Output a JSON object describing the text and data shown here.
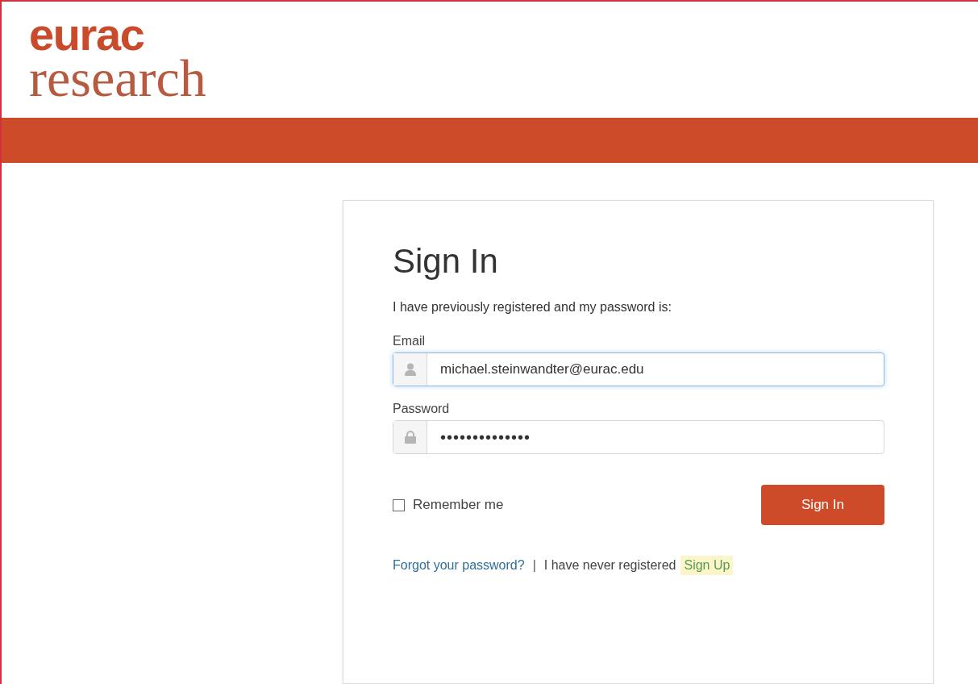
{
  "logo": {
    "top": "eurac",
    "bottom": "research"
  },
  "card": {
    "title": "Sign In",
    "intro": "I have previously registered and my password is:",
    "fields": [
      {
        "kind": "email",
        "label": "Email",
        "value": "michael.steinwandter@eurac.edu",
        "focused": true
      },
      {
        "kind": "password",
        "label": "Password",
        "value": "••••••••••••••",
        "focused": false
      }
    ],
    "remember": {
      "label": "Remember me",
      "checked": false
    },
    "submit": "Sign In",
    "footer": {
      "forgot": "Forgot your password?",
      "separator": "|",
      "never": "I have never registered",
      "signup": "Sign Up"
    }
  }
}
